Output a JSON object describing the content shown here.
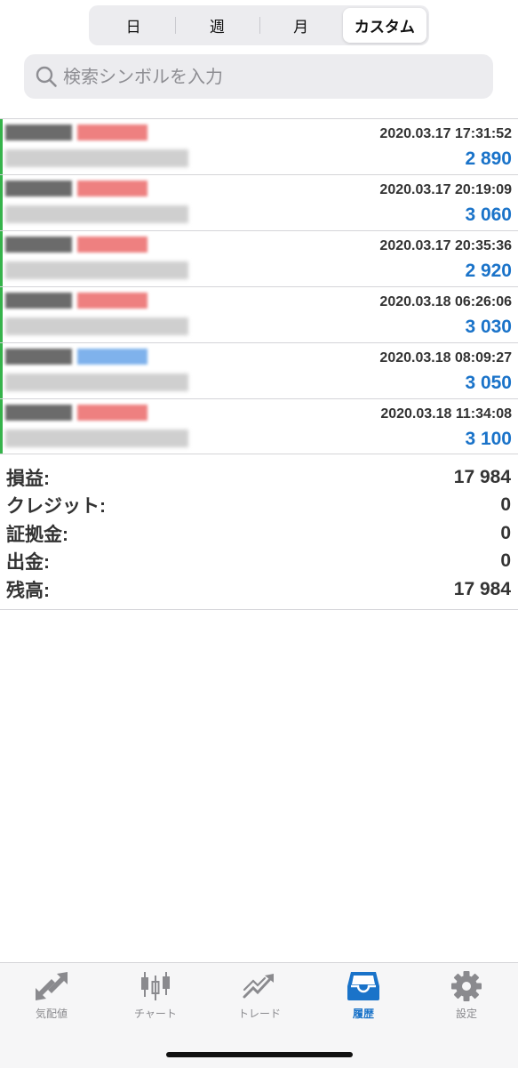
{
  "segmented": {
    "items": [
      "日",
      "週",
      "月",
      "カスタム"
    ],
    "active_index": 3
  },
  "search": {
    "placeholder": "検索シンボルを入力"
  },
  "rows": [
    {
      "time": "2020.03.17 17:31:52",
      "amount": "2 890",
      "type_color": "#ee8080"
    },
    {
      "time": "2020.03.17 20:19:09",
      "amount": "3 060",
      "type_color": "#ee8080"
    },
    {
      "time": "2020.03.17 20:35:36",
      "amount": "2 920",
      "type_color": "#ee8080"
    },
    {
      "time": "2020.03.18 06:26:06",
      "amount": "3 030",
      "type_color": "#ee8080"
    },
    {
      "time": "2020.03.18 08:09:27",
      "amount": "3 050",
      "type_color": "#7fb2ec"
    },
    {
      "time": "2020.03.18 11:34:08",
      "amount": "3 100",
      "type_color": "#ee8080"
    }
  ],
  "summary": [
    {
      "label": "損益:",
      "value": "17 984"
    },
    {
      "label": "クレジット:",
      "value": "0"
    },
    {
      "label": "証拠金:",
      "value": "0"
    },
    {
      "label": "出金:",
      "value": "0"
    },
    {
      "label": "残高:",
      "value": "17 984"
    }
  ],
  "tabs": [
    {
      "label": "気配値",
      "icon": "quotes-arrows-icon"
    },
    {
      "label": "チャート",
      "icon": "candlestick-icon"
    },
    {
      "label": "トレード",
      "icon": "trade-icon"
    },
    {
      "label": "履歴",
      "icon": "history-inbox-icon"
    },
    {
      "label": "設定",
      "icon": "gear-icon"
    }
  ],
  "colors": {
    "accent": "#1a73c9",
    "inactive": "#8a8a8e",
    "positive_bar": "#35b34a"
  }
}
